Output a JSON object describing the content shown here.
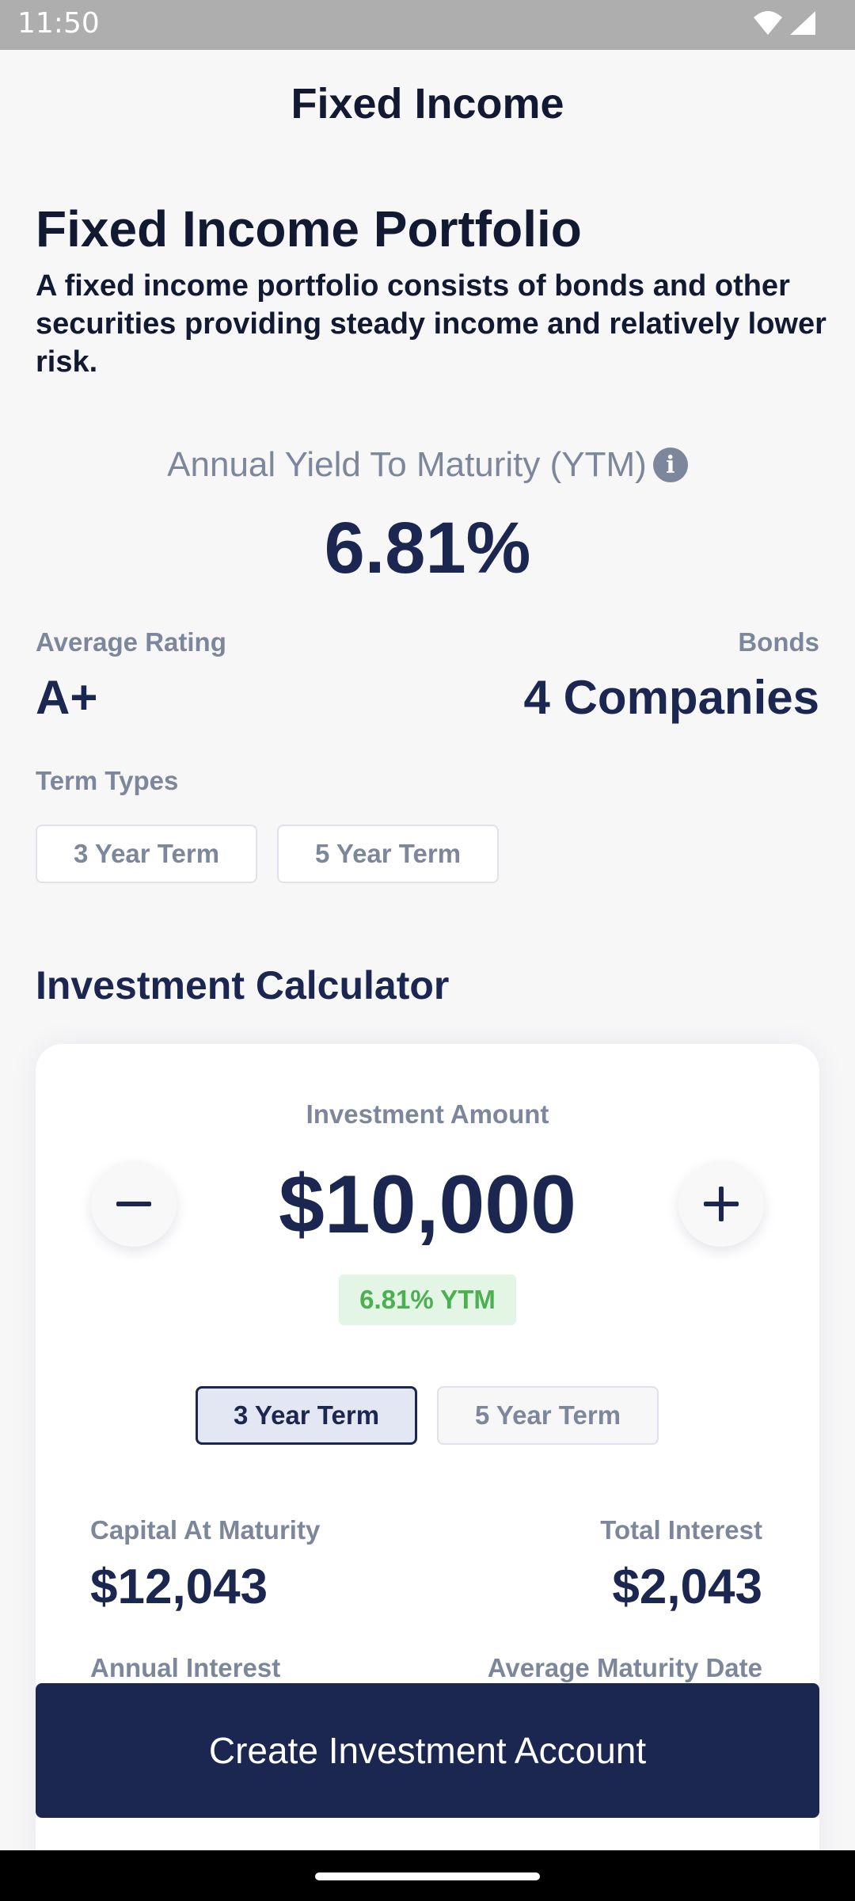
{
  "status_bar": {
    "time": "11:50",
    "icons": [
      "wifi-icon",
      "signal-icon"
    ]
  },
  "header": {
    "title": "Fixed Income"
  },
  "portfolio": {
    "title": "Fixed Income Portfolio",
    "description": "A fixed income portfolio consists of bonds and other securities providing steady income and relatively lower risk."
  },
  "yield": {
    "label": "Annual Yield To Maturity (YTM)",
    "value": "6.81%",
    "info_icon": "info-icon"
  },
  "stats": {
    "avg_rating_label": "Average Rating",
    "avg_rating_value": "A+",
    "bonds_label": "Bonds",
    "bonds_value": "4 Companies"
  },
  "term_types": {
    "label": "Term Types",
    "options": [
      "3 Year Term",
      "5 Year Term"
    ]
  },
  "calculator": {
    "title": "Investment Calculator",
    "amount_label": "Investment Amount",
    "amount": "$10,000",
    "ytm_badge": "6.81% YTM",
    "terms": [
      "3 Year Term",
      "5 Year Term"
    ],
    "selected_term": "3 Year Term",
    "capital_label": "Capital At Maturity",
    "capital_value": "$12,043",
    "interest_label": "Total Interest",
    "interest_value": "$2,043",
    "annual_interest_label": "Annual Interest",
    "avg_maturity_label": "Average Maturity Date"
  },
  "cta": {
    "label": "Create Investment Account"
  },
  "colors": {
    "primary": "#1b2750",
    "muted": "#7d879c",
    "success": "#4caf50",
    "success_bg": "#e3f5e4",
    "status_bar": "#aeaeae"
  }
}
